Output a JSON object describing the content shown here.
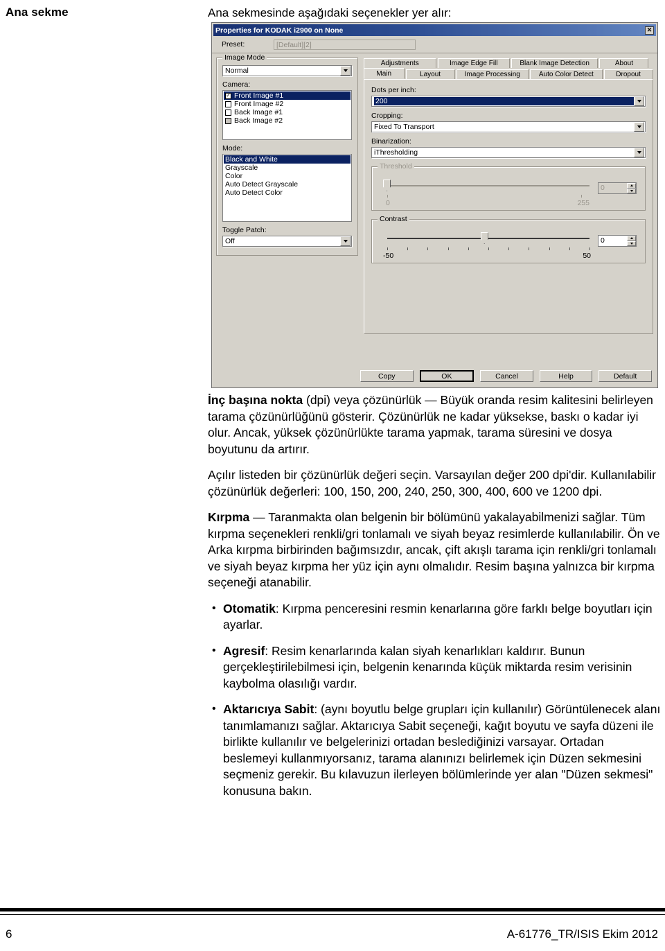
{
  "page": {
    "marginal_title": "Ana sekme",
    "intro": "Ana sekmesinde aşağıdaki seçenekler yer alır:"
  },
  "dialog": {
    "title": "Properties for KODAK i2900 on None",
    "close_icon": "close-icon",
    "preset": {
      "label": "Preset:",
      "value": "[Default][2]"
    },
    "left_panel": {
      "image_mode_group_title": "Image Mode",
      "image_mode_value": "Normal",
      "camera_label": "Camera:",
      "camera_items": [
        {
          "label": "Front Image #1",
          "checked": true,
          "selected": true,
          "disabled": false
        },
        {
          "label": "Front Image #2",
          "checked": false,
          "selected": false,
          "disabled": false
        },
        {
          "label": "Back Image #1",
          "checked": false,
          "selected": false,
          "disabled": false
        },
        {
          "label": "Back Image #2",
          "checked": false,
          "selected": false,
          "disabled": true
        }
      ],
      "mode_label": "Mode:",
      "mode_items": [
        {
          "label": "Black and White",
          "selected": true
        },
        {
          "label": "Grayscale",
          "selected": false
        },
        {
          "label": "Color",
          "selected": false
        },
        {
          "label": "Auto Detect Grayscale",
          "selected": false
        },
        {
          "label": "Auto Detect Color",
          "selected": false
        }
      ],
      "toggle_patch_label": "Toggle Patch:",
      "toggle_patch_value": "Off"
    },
    "tabs_top": [
      "Adjustments",
      "Image Edge Fill",
      "Blank Image Detection",
      "About"
    ],
    "tabs_bottom": [
      "Main",
      "Layout",
      "Image Processing",
      "Auto Color Detect",
      "Dropout"
    ],
    "active_tab": "Main",
    "main_tab": {
      "dpi_label": "Dots per inch:",
      "dpi_value": "200",
      "cropping_label": "Cropping:",
      "cropping_value": "Fixed To Transport",
      "binarization_label": "Binarization:",
      "binarization_value": "iThresholding",
      "threshold": {
        "title": "Threshold",
        "min_label": "0",
        "max_label": "255",
        "value": "0",
        "enabled": false,
        "thumb_pct": 0
      },
      "contrast": {
        "title": "Contrast",
        "min_label": "-50",
        "max_label": "50",
        "value": "0",
        "enabled": true,
        "thumb_pct": 50
      }
    },
    "buttons": [
      "Copy",
      "OK",
      "Cancel",
      "Help",
      "Default"
    ],
    "default_button": "OK",
    "accent_titlebar": "#18337a",
    "accent_selection": "#0a246a",
    "face_color": "#d4d0c8"
  },
  "body": {
    "p1_bold": "İnç başına nokta",
    "p1_rest": " (dpi) veya çözünürlük — Büyük oranda resim kalitesini belirleyen tarama çözünürlüğünü gösterir. Çözünürlük ne kadar yüksekse, baskı o kadar iyi olur. Ancak, yüksek çözünürlükte tarama yapmak, tarama süresini ve dosya boyutunu da artırır.",
    "p2": "Açılır listeden bir çözünürlük değeri seçin. Varsayılan değer 200 dpi'dir. Kullanılabilir çözünürlük değerleri: 100, 150, 200, 240, 250, 300, 400, 600 ve 1200 dpi.",
    "p3_bold": "Kırpma",
    "p3_rest": " — Taranmakta olan belgenin bir bölümünü yakalayabilmenizi sağlar. Tüm kırpma seçenekleri renkli/gri tonlamalı ve siyah beyaz resimlerde kullanılabilir. Ön ve Arka kırpma birbirinden bağımsızdır, ancak, çift akışlı tarama için renkli/gri tonlamalı ve siyah beyaz kırpma her yüz için aynı olmalıdır. Resim başına yalnızca bir kırpma seçeneği atanabilir.",
    "bullets": [
      {
        "term": "Otomatik",
        "text": ": Kırpma penceresini resmin kenarlarına göre farklı belge boyutları için ayarlar."
      },
      {
        "term": "Agresif",
        "text": ": Resim kenarlarında kalan siyah kenarlıkları kaldırır. Bunun gerçekleştirilebilmesi için, belgenin kenarında küçük miktarda resim verisinin kaybolma olasılığı vardır."
      },
      {
        "term": "Aktarıcıya Sabit",
        "text": ": (aynı boyutlu belge grupları için kullanılır) Görüntülenecek alanı tanımlamanızı sağlar. Aktarıcıya Sabit seçeneği, kağıt boyutu ve sayfa düzeni ile birlikte kullanılır ve belgelerinizi ortadan beslediğinizi varsayar. Ortadan beslemeyi kullanmıyorsanız, tarama alanınızı belirlemek için Düzen sekmesini seçmeniz gerekir. Bu kılavuzun ilerleyen bölümlerinde yer alan \"Düzen sekmesi\" konusuna bakın."
      }
    ]
  },
  "footer": {
    "page_number": "6",
    "doc_id": "A-61776_TR/ISIS Ekim 2012"
  }
}
